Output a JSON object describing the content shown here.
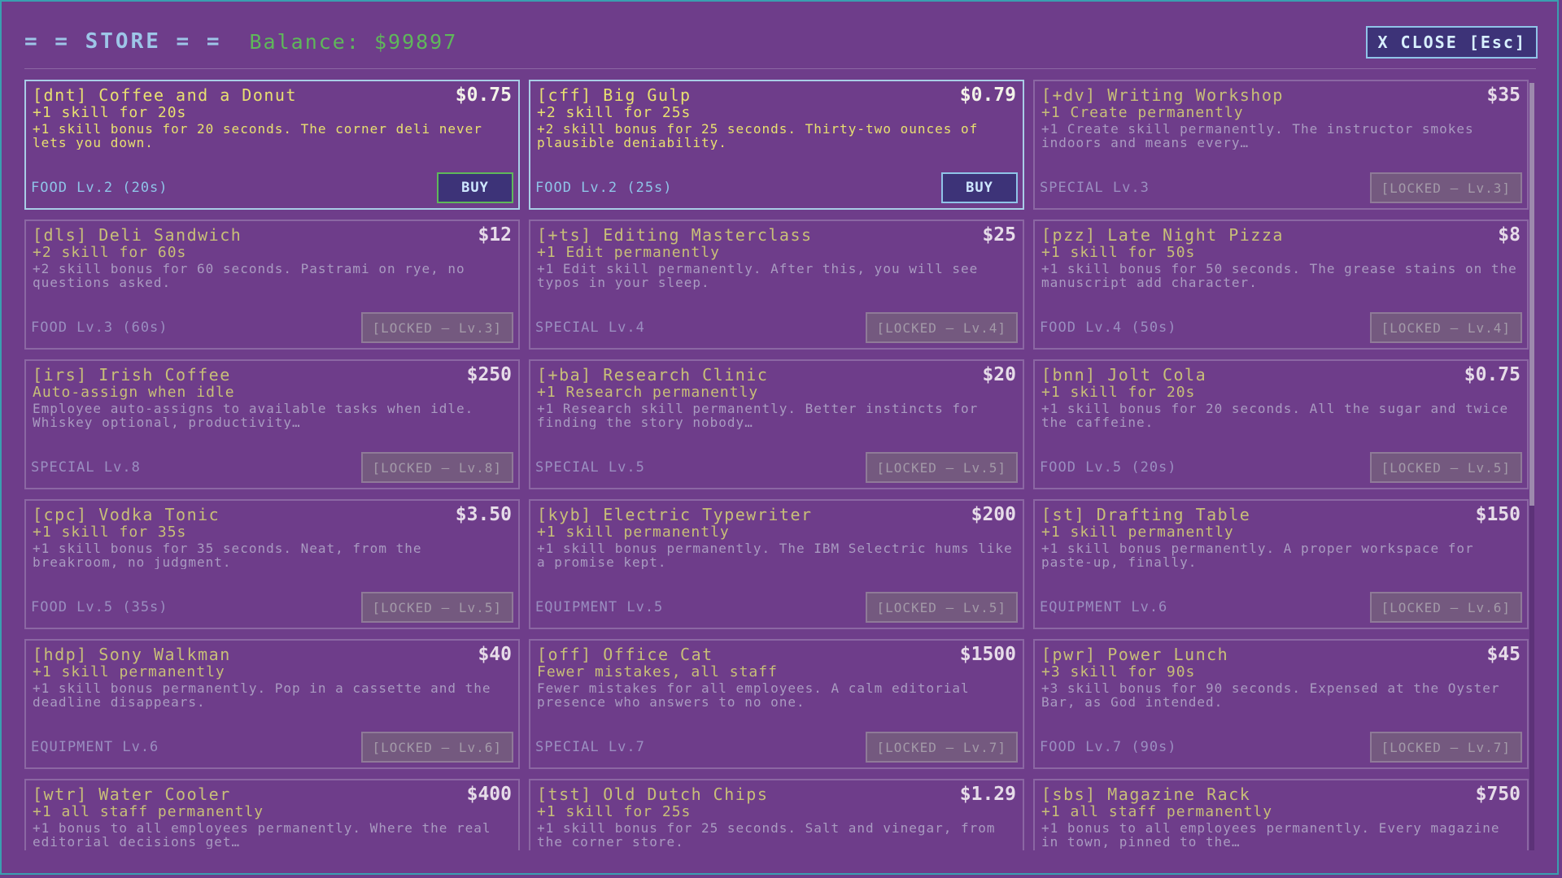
{
  "header": {
    "title": "= = STORE = =",
    "balance": "Balance: $99897",
    "close_label": "X CLOSE [Esc]"
  },
  "buy_label": "BUY",
  "items": [
    {
      "name": "[dnt] Coffee and a Donut",
      "price": "$0.75",
      "effect": "+1 skill for 20s",
      "desc": "+1 skill bonus for 20 seconds. The corner deli never lets you down.",
      "category": "FOOD Lv.2 (20s)",
      "status": "buy",
      "button": "BUY",
      "btn_style": "green"
    },
    {
      "name": "[cff] Big Gulp",
      "price": "$0.79",
      "effect": "+2 skill for 25s",
      "desc": "+2 skill bonus for 25 seconds. Thirty-two ounces of plausible deniability.",
      "category": "FOOD Lv.2 (25s)",
      "status": "buy",
      "button": "BUY",
      "btn_style": "blue"
    },
    {
      "name": "[+dv] Writing Workshop",
      "price": "$35",
      "effect": "+1 Create permanently",
      "desc": "+1 Create skill permanently. The instructor smokes indoors and means every…",
      "category": "SPECIAL Lv.3",
      "status": "locked",
      "button": "[LOCKED — Lv.3]"
    },
    {
      "name": "[dls] Deli Sandwich",
      "price": "$12",
      "effect": "+2 skill for 60s",
      "desc": "+2 skill bonus for 60 seconds. Pastrami on rye, no questions asked.",
      "category": "FOOD Lv.3 (60s)",
      "status": "locked",
      "button": "[LOCKED — Lv.3]"
    },
    {
      "name": "[+ts] Editing Masterclass",
      "price": "$25",
      "effect": "+1 Edit permanently",
      "desc": "+1 Edit skill permanently. After this, you will see typos in your sleep.",
      "category": "SPECIAL Lv.4",
      "status": "locked",
      "button": "[LOCKED — Lv.4]"
    },
    {
      "name": "[pzz] Late Night Pizza",
      "price": "$8",
      "effect": "+1 skill for 50s",
      "desc": "+1 skill bonus for 50 seconds. The grease stains on the manuscript add character.",
      "category": "FOOD Lv.4 (50s)",
      "status": "locked",
      "button": "[LOCKED — Lv.4]"
    },
    {
      "name": "[irs] Irish Coffee",
      "price": "$250",
      "effect": "Auto-assign when idle",
      "desc": "Employee auto-assigns to available tasks when idle. Whiskey optional, productivity…",
      "category": "SPECIAL Lv.8",
      "status": "locked",
      "button": "[LOCKED — Lv.8]"
    },
    {
      "name": "[+ba] Research Clinic",
      "price": "$20",
      "effect": "+1 Research permanently",
      "desc": "+1 Research skill permanently. Better instincts for finding the story nobody…",
      "category": "SPECIAL Lv.5",
      "status": "locked",
      "button": "[LOCKED — Lv.5]"
    },
    {
      "name": "[bnn] Jolt Cola",
      "price": "$0.75",
      "effect": "+1 skill for 20s",
      "desc": "+1 skill bonus for 20 seconds. All the sugar and twice the caffeine.",
      "category": "FOOD Lv.5 (20s)",
      "status": "locked",
      "button": "[LOCKED — Lv.5]"
    },
    {
      "name": "[cpc] Vodka Tonic",
      "price": "$3.50",
      "effect": "+1 skill for 35s",
      "desc": "+1 skill bonus for 35 seconds. Neat, from the breakroom, no judgment.",
      "category": "FOOD Lv.5 (35s)",
      "status": "locked",
      "button": "[LOCKED — Lv.5]"
    },
    {
      "name": "[kyb] Electric Typewriter",
      "price": "$200",
      "effect": "+1 skill permanently",
      "desc": "+1 skill bonus permanently. The IBM Selectric hums like a promise kept.",
      "category": "EQUIPMENT Lv.5",
      "status": "locked",
      "button": "[LOCKED — Lv.5]"
    },
    {
      "name": "[st] Drafting Table",
      "price": "$150",
      "effect": "+1 skill permanently",
      "desc": "+1 skill bonus permanently. A proper workspace for paste-up, finally.",
      "category": "EQUIPMENT Lv.6",
      "status": "locked",
      "button": "[LOCKED — Lv.6]"
    },
    {
      "name": "[hdp] Sony Walkman",
      "price": "$40",
      "effect": "+1 skill permanently",
      "desc": "+1 skill bonus permanently. Pop in a cassette and the deadline disappears.",
      "category": "EQUIPMENT Lv.6",
      "status": "locked",
      "button": "[LOCKED — Lv.6]"
    },
    {
      "name": "[off] Office Cat",
      "price": "$1500",
      "effect": "Fewer mistakes, all staff",
      "desc": "Fewer mistakes for all employees. A calm editorial presence who answers to no one.",
      "category": "SPECIAL Lv.7",
      "status": "locked",
      "button": "[LOCKED — Lv.7]"
    },
    {
      "name": "[pwr] Power Lunch",
      "price": "$45",
      "effect": "+3 skill for 90s",
      "desc": "+3 skill bonus for 90 seconds. Expensed at the Oyster Bar, as God intended.",
      "category": "FOOD Lv.7 (90s)",
      "status": "locked",
      "button": "[LOCKED — Lv.7]"
    },
    {
      "name": "[wtr] Water Cooler",
      "price": "$400",
      "effect": "+1 all staff permanently",
      "desc": "+1 bonus to all employees permanently. Where the real editorial decisions get…",
      "category": "",
      "status": "locked",
      "button": ""
    },
    {
      "name": "[tst] Old Dutch Chips",
      "price": "$1.29",
      "effect": "+1 skill for 25s",
      "desc": "+1 skill bonus for 25 seconds. Salt and vinegar, from the corner store.",
      "category": "",
      "status": "locked",
      "button": ""
    },
    {
      "name": "[sbs] Magazine Rack",
      "price": "$750",
      "effect": "+1 all staff permanently",
      "desc": "+1 bonus to all employees permanently. Every magazine in town, pinned to the…",
      "category": "",
      "status": "locked",
      "button": ""
    }
  ],
  "colors": {
    "background": "#6e3d8a",
    "title": "#9ec6e8",
    "balance": "#5fb85a",
    "text": "#e8e070",
    "available_border": "#a9cde6",
    "locked_border": "#8b67a3"
  }
}
